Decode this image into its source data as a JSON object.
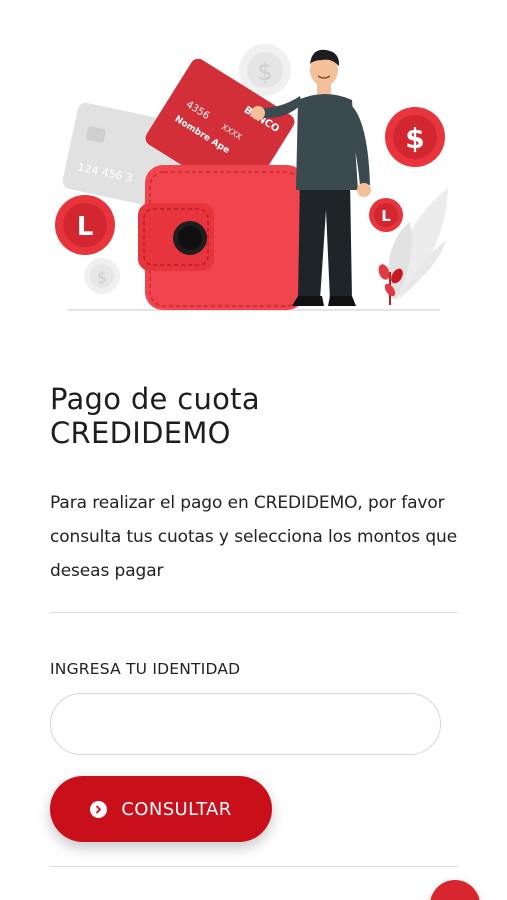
{
  "page": {
    "title_line1": "Pago de cuota",
    "title_line2": "CREDIDEMO",
    "description": "Para realizar el pago en CREDIDEMO, por favor consulta tus cuotas y selecciona los montos que deseas pagar"
  },
  "form": {
    "identity_label": "INGRESA TU IDENTIDAD",
    "identity_value": "",
    "consult_button": "CONSULTAR",
    "consult_icon": "chevron-right-circle-icon"
  },
  "illustration": {
    "card_bank_label": "BANCO",
    "card_number_partial": "4356",
    "card_number_mask": "XXXX",
    "card_name_partial": "Nombre Ape",
    "back_card_number_partial": "124 456 3",
    "coin_symbol_dollar": "$",
    "coin_symbol_l": "L",
    "icons": [
      "wallet-icon",
      "credit-card-icon",
      "coin-icon",
      "person-illustration",
      "plant-icon"
    ]
  },
  "colors": {
    "brand_red": "#c9101a",
    "wallet_red": "#f0444e",
    "coin_red": "#e8343d",
    "person_shirt": "#3a4a4e",
    "person_pants": "#1d2528"
  }
}
